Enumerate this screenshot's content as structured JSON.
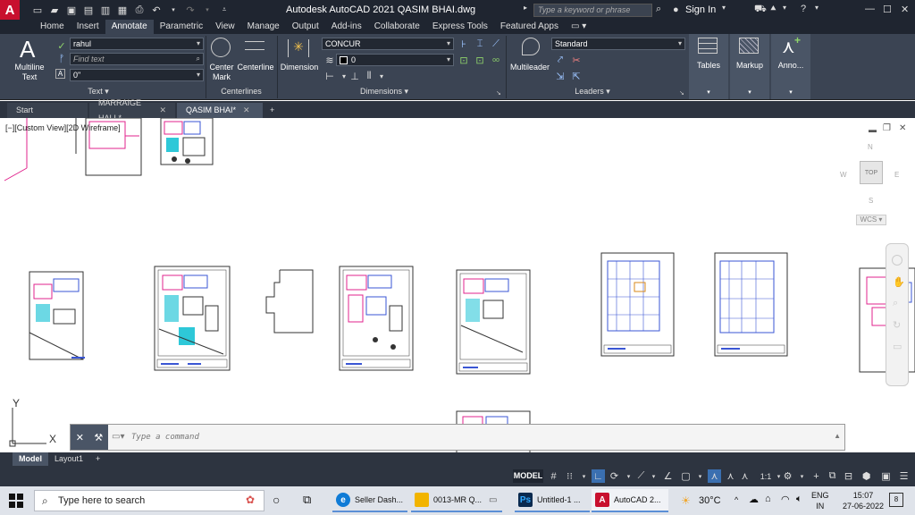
{
  "titlebar": {
    "app_letter": "A",
    "title": "Autodesk AutoCAD 2021   QASIM BHAI.dwg",
    "search_placeholder": "Type a keyword or phrase",
    "signin": "Sign In"
  },
  "ribbon_tabs": [
    "Home",
    "Insert",
    "Annotate",
    "Parametric",
    "View",
    "Manage",
    "Output",
    "Add-ins",
    "Collaborate",
    "Express Tools",
    "Featured Apps"
  ],
  "active_ribbon_tab": "Annotate",
  "ribbon": {
    "text_panel": {
      "multiline_label": "Multiline\nText",
      "text_style": "rahul",
      "find_placeholder": "Find text",
      "height": "0\"",
      "panel_title": "Text"
    },
    "centerlines_panel": {
      "center_mark": "Center\nMark",
      "centerline": "Centerline",
      "panel_title": "Centerlines"
    },
    "dimensions_panel": {
      "dimension": "Dimension",
      "dim_style": "CONCUR",
      "dim_layer": "0",
      "panel_title": "Dimensions"
    },
    "leaders_panel": {
      "multileader": "Multileader",
      "style": "Standard",
      "panel_title": "Leaders"
    },
    "tables": "Tables",
    "markup": "Markup",
    "annotation": "Anno..."
  },
  "file_tabs": [
    {
      "label": "Start",
      "closable": false
    },
    {
      "label": "MARRAIGE HALL*",
      "closable": true
    },
    {
      "label": "QASIM BHAI*",
      "closable": true
    }
  ],
  "drawing": {
    "view_label": "[−][Custom View][2D Wireframe]",
    "viewcube_top": "TOP",
    "compass_n": "N",
    "compass_s": "S",
    "compass_e": "E",
    "compass_w": "W",
    "wcs": "WCS",
    "ucs_x": "X",
    "ucs_y": "Y"
  },
  "command": {
    "placeholder": "Type a command"
  },
  "layout_tabs": [
    "Model",
    "Layout1"
  ],
  "status": {
    "model": "MODEL",
    "scale": "1:1"
  },
  "taskbar": {
    "search": "Type here to search",
    "apps": [
      {
        "label": "Seller Dash...",
        "icon": "edge-icon",
        "color": "#0f7bd6"
      },
      {
        "label": "0013-MR Q...",
        "icon": "folder-icon",
        "color": "#f2b400"
      },
      {
        "label": "Untitled-1 ...",
        "icon": "photoshop-icon",
        "color": "#0a2a4f"
      },
      {
        "label": "AutoCAD 2...",
        "icon": "autocad-icon",
        "color": "#c8102e"
      }
    ],
    "weather": "30°C",
    "lang_top": "ENG",
    "lang_bottom": "IN",
    "time": "15:07",
    "date": "27-06-2022",
    "notif_count": "8"
  }
}
